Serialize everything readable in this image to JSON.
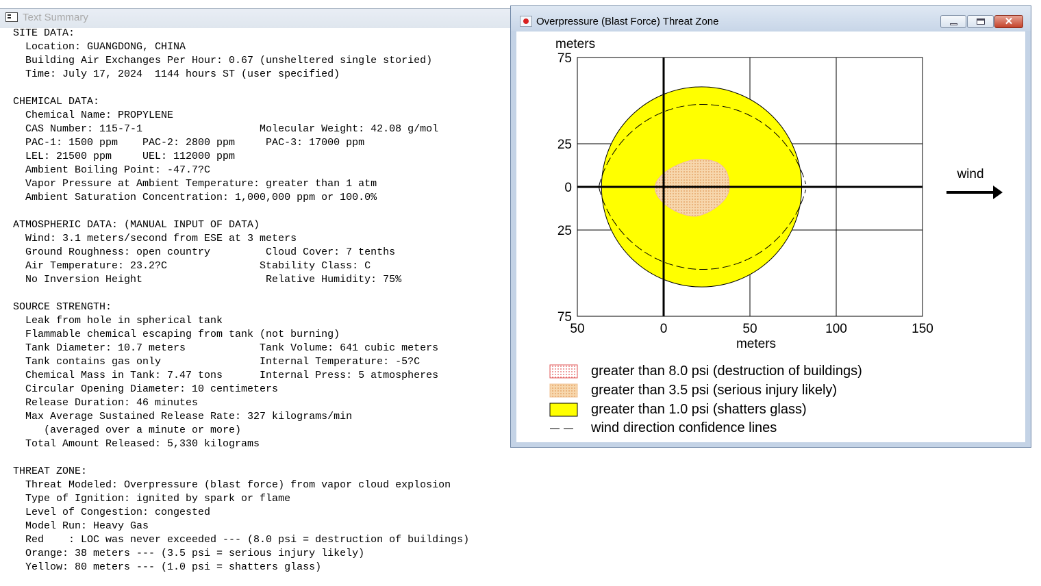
{
  "summary_window": {
    "title": "Text Summary",
    "sections": [
      {
        "header": "SITE DATA:",
        "lines": [
          "  Location: GUANGDONG, CHINA",
          "  Building Air Exchanges Per Hour: 0.67 (unsheltered single storied)",
          "  Time: July 17, 2024  1144 hours ST (user specified)"
        ]
      },
      {
        "header": "CHEMICAL DATA:",
        "lines": [
          "  Chemical Name: PROPYLENE",
          "  CAS Number: 115-7-1                   Molecular Weight: 42.08 g/mol",
          "  PAC-1: 1500 ppm    PAC-2: 2800 ppm     PAC-3: 17000 ppm",
          "  LEL: 21500 ppm     UEL: 112000 ppm",
          "  Ambient Boiling Point: -47.7?C",
          "  Vapor Pressure at Ambient Temperature: greater than 1 atm",
          "  Ambient Saturation Concentration: 1,000,000 ppm or 100.0%"
        ]
      },
      {
        "header": "ATMOSPHERIC DATA: (MANUAL INPUT OF DATA)",
        "lines": [
          "  Wind: 3.1 meters/second from ESE at 3 meters",
          "  Ground Roughness: open country         Cloud Cover: 7 tenths",
          "  Air Temperature: 23.2?C               Stability Class: C",
          "  No Inversion Height                    Relative Humidity: 75%"
        ]
      },
      {
        "header": "SOURCE STRENGTH:",
        "lines": [
          "  Leak from hole in spherical tank",
          "  Flammable chemical escaping from tank (not burning)",
          "  Tank Diameter: 10.7 meters            Tank Volume: 641 cubic meters",
          "  Tank contains gas only                Internal Temperature: -5?C",
          "  Chemical Mass in Tank: 7.47 tons      Internal Press: 5 atmospheres",
          "  Circular Opening Diameter: 10 centimeters",
          "  Release Duration: 46 minutes",
          "  Max Average Sustained Release Rate: 327 kilograms/min",
          "     (averaged over a minute or more)",
          "  Total Amount Released: 5,330 kilograms"
        ]
      },
      {
        "header": "THREAT ZONE:",
        "lines": [
          "  Threat Modeled: Overpressure (blast force) from vapor cloud explosion",
          "  Type of Ignition: ignited by spark or flame",
          "  Level of Congestion: congested",
          "  Model Run: Heavy Gas",
          "  Red    : LOC was never exceeded --- (8.0 psi = destruction of buildings)",
          "  Orange: 38 meters --- (3.5 psi = serious injury likely)",
          "  Yellow: 80 meters --- (1.0 psi = shatters glass)"
        ]
      }
    ]
  },
  "threat_window": {
    "title": "Overpressure (Blast Force) Threat Zone",
    "close_glyph": "✕",
    "plot": {
      "y_unit_label": "meters",
      "x_axis_label": "meters",
      "wind_label": "wind",
      "x_tick_labels": [
        "50",
        "0",
        "50",
        "100",
        "150"
      ],
      "y_tick_labels": [
        "75",
        "25",
        "0",
        "25",
        "75"
      ]
    },
    "legend": [
      {
        "label": "greater than 8.0 psi (destruction of buildings)",
        "color": "#f4b8b8"
      },
      {
        "label": "greater than 3.5 psi (serious injury likely)",
        "color": "#f5cc9c"
      },
      {
        "label": "greater than 1.0 psi (shatters glass)",
        "color": "#ffff00"
      },
      {
        "label": "wind direction confidence lines",
        "color": "#000000"
      }
    ]
  },
  "chart_data": {
    "type": "area",
    "title": "Overpressure (Blast Force) Threat Zone",
    "xlabel": "meters",
    "ylabel": "meters",
    "xlim": [
      -50,
      150
    ],
    "ylim": [
      -75,
      75
    ],
    "x_ticks": [
      -50,
      0,
      50,
      100,
      150
    ],
    "y_ticks": [
      75,
      25,
      0,
      -25,
      -75
    ],
    "grid": true,
    "zones": [
      {
        "name": "greater than 8.0 psi (destruction of buildings)",
        "color": "#f4b8b8",
        "max_downwind_m": null
      },
      {
        "name": "greater than 3.5 psi (serious injury likely)",
        "color": "#f5cc9c",
        "x_range": [
          -5,
          38
        ],
        "y_range": [
          -17,
          16
        ]
      },
      {
        "name": "greater than 1.0 psi (shatters glass)",
        "color": "#ffff00",
        "center": [
          22,
          0
        ],
        "radius_x": 58,
        "radius_y": 58,
        "max_downwind_m": 80
      }
    ],
    "confidence_lines": {
      "color": "#000000",
      "style": "dashed"
    },
    "wind_direction": "left-to-right"
  }
}
